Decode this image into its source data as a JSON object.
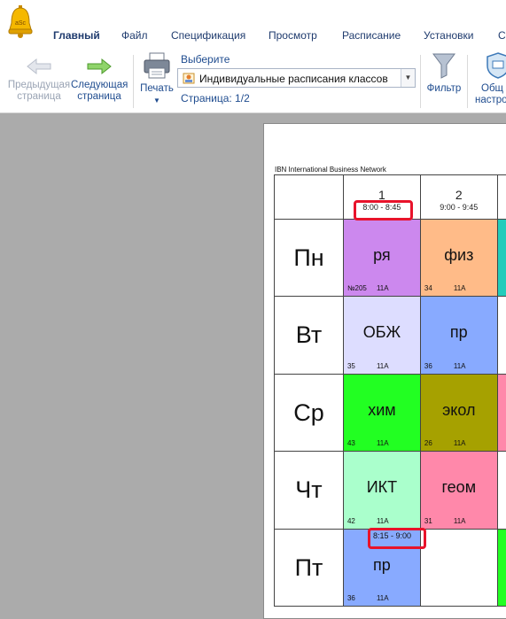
{
  "app": {
    "logo_text": "aSc"
  },
  "tabs": [
    {
      "label": "Главный",
      "active": true
    },
    {
      "label": "Файл"
    },
    {
      "label": "Спецификация"
    },
    {
      "label": "Просмотр"
    },
    {
      "label": "Расписание"
    },
    {
      "label": "Установки"
    },
    {
      "label": "С"
    }
  ],
  "ribbon": {
    "prev_line1": "Предыдущая",
    "prev_line2": "страница",
    "next_line1": "Следующая",
    "next_line2": "страница",
    "print": "Печать",
    "select_title": "Выберите",
    "select_value": "Индивидуальные расписания классов",
    "page_info": "Страница: 1/2",
    "filter": "Фильтр",
    "general_line1": "Общ",
    "general_line2": "настро"
  },
  "document": {
    "org": "IBN International Business Network",
    "periods": [
      {
        "num": "1",
        "time": "8:00 - 8:45"
      },
      {
        "num": "2",
        "time": "9:00 - 9:45"
      }
    ],
    "days": [
      {
        "name": "Пн",
        "lessons": [
          {
            "subject": "ря",
            "room": "№205",
            "class": "11А",
            "color": "#cc88ee"
          },
          {
            "subject": "физ",
            "room": "34",
            "class": "11А",
            "color": "#ffbb88"
          }
        ]
      },
      {
        "name": "Вт",
        "lessons": [
          {
            "subject": "ОБЖ",
            "room": "35",
            "class": "11А",
            "color": "#ddddff"
          },
          {
            "subject": "пр",
            "room": "36",
            "class": "11А",
            "color": "#88aaff"
          }
        ]
      },
      {
        "name": "Ср",
        "lessons": [
          {
            "subject": "хим",
            "room": "43",
            "class": "11А",
            "color": "#22ff22"
          },
          {
            "subject": "экол",
            "room": "26",
            "class": "11А",
            "color": "#a6a100"
          }
        ]
      },
      {
        "name": "Чт",
        "lessons": [
          {
            "subject": "ИКТ",
            "room": "42",
            "class": "11А",
            "color": "#aaffcc"
          },
          {
            "subject": "геом",
            "room": "31",
            "class": "11А",
            "color": "#ff88aa"
          }
        ]
      },
      {
        "name": "Пт",
        "lessons": [
          {
            "subject": "пр",
            "room": "36",
            "class": "11А",
            "color": "#88aaff",
            "time": "8:15 - 9:00"
          },
          {
            "subject": "",
            "room": "",
            "class": "",
            "color": "#ffffff"
          }
        ]
      }
    ]
  },
  "colors": {
    "accent": "#1f3b6e",
    "highlight": "#e8132b"
  }
}
